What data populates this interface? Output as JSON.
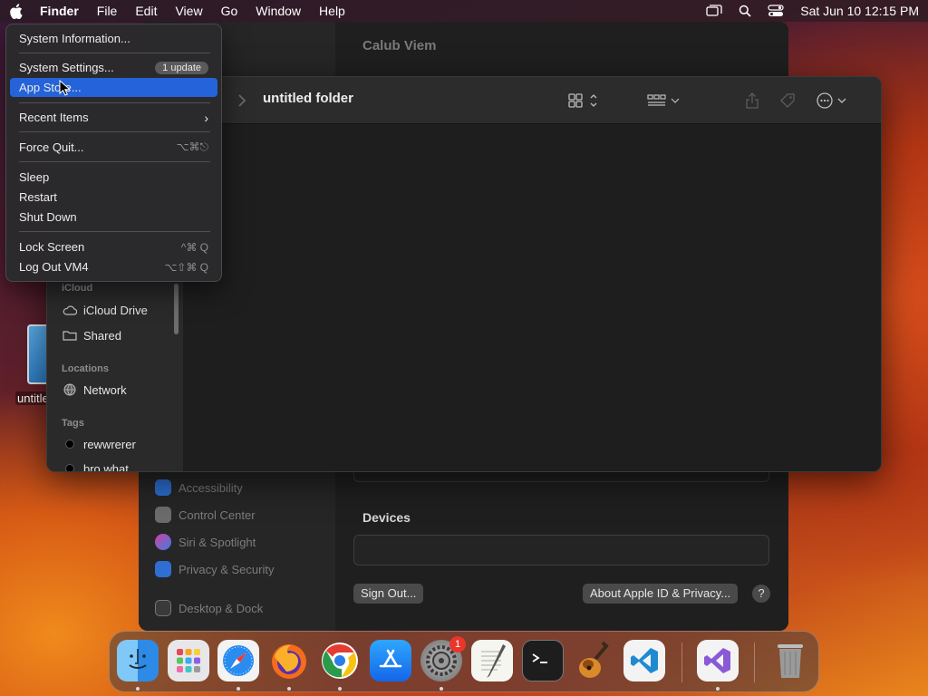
{
  "menubar": {
    "items": [
      "Finder",
      "File",
      "Edit",
      "View",
      "Go",
      "Window",
      "Help"
    ],
    "clock": "Sat Jun 10  12:15 PM"
  },
  "apple_menu": {
    "system_info": "System Information...",
    "system_settings": "System Settings...",
    "update_badge": "1 update",
    "app_store": "App Store...",
    "recent_items": "Recent Items",
    "force_quit": "Force Quit...",
    "force_quit_shortcut": "⌥⌘⎋",
    "sleep": "Sleep",
    "restart": "Restart",
    "shut_down": "Shut Down",
    "lock_screen": "Lock Screen",
    "lock_screen_shortcut": "^⌘ Q",
    "log_out": "Log Out VM4",
    "log_out_shortcut": "⌥⇧⌘ Q"
  },
  "settings_window": {
    "title": "Calub Viem",
    "sidebar": [
      "Accessibility",
      "Control Center",
      "Siri & Spotlight",
      "Privacy & Security",
      "Desktop & Dock"
    ],
    "devices_label": "Devices",
    "sign_out": "Sign Out...",
    "about": "About Apple ID & Privacy...",
    "help": "?"
  },
  "finder": {
    "folder_title": "untitled folder",
    "sections": {
      "icloud": "iCloud",
      "locations": "Locations",
      "tags": "Tags"
    },
    "icloud_items": [
      "iCloud Drive",
      "Shared"
    ],
    "location_items": [
      "Network"
    ],
    "tag_items": [
      "rewwrerer",
      "bro what"
    ]
  },
  "desktop": {
    "item_label": "untitled"
  },
  "dock": {
    "apps": [
      "Finder",
      "Launchpad",
      "Safari",
      "Firefox",
      "Chrome",
      "App Store",
      "System Settings",
      "TextEdit",
      "Terminal",
      "GarageBand",
      "Visual Studio Code",
      "Visual Studio",
      "Trash"
    ],
    "settings_badge": "1"
  },
  "colors": {
    "menu_highlight": "#2463d9",
    "badge_red": "#e8362c"
  }
}
